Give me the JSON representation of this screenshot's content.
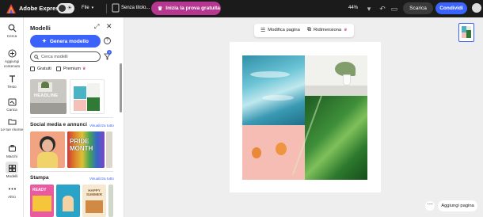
{
  "topbar": {
    "brand": "Adobe Express",
    "file_menu": "File",
    "doc_title": "Senza titolo...",
    "trial_button": "Inizia la prova gratuita",
    "zoom": "44%",
    "download": "Scarica",
    "share": "Condividi"
  },
  "rail": [
    {
      "label": "Cerca",
      "icon": "search-icon"
    },
    {
      "label": "Aggiungi contenuto",
      "icon": "add-icon"
    },
    {
      "label": "Testo",
      "icon": "text-icon"
    },
    {
      "label": "Carica",
      "icon": "upload-icon"
    },
    {
      "label": "Le tue risorse",
      "icon": "folder-icon"
    },
    {
      "label": "Marchi",
      "icon": "brand-icon"
    },
    {
      "label": "Modelli",
      "icon": "templates-icon"
    },
    {
      "label": "Altro",
      "icon": "more-icon"
    }
  ],
  "panel": {
    "title": "Modelli",
    "generate_button": "Genera modello",
    "search_placeholder": "Cerca modelli",
    "filter_badge": "1",
    "filter_free": "Gratuiti",
    "filter_premium": "Premium",
    "section_social": "Social media e annunci",
    "section_print": "Stampa",
    "see_all": "Visualizza tutto",
    "headline_thumb_text": "HEADLINE",
    "pride_thumb_text": "PRIDE MONTH",
    "print_thumb_1": "READY",
    "print_thumb_2": "HAPPY SUMMER"
  },
  "canvas": {
    "edit_page": "Modifica pagina",
    "resize": "Ridimensiona",
    "add_page": "Aggiungi pagina"
  },
  "colors": {
    "accent": "#3b63fb",
    "trial": "#b5378f",
    "topbar": "#1b1b1b"
  }
}
